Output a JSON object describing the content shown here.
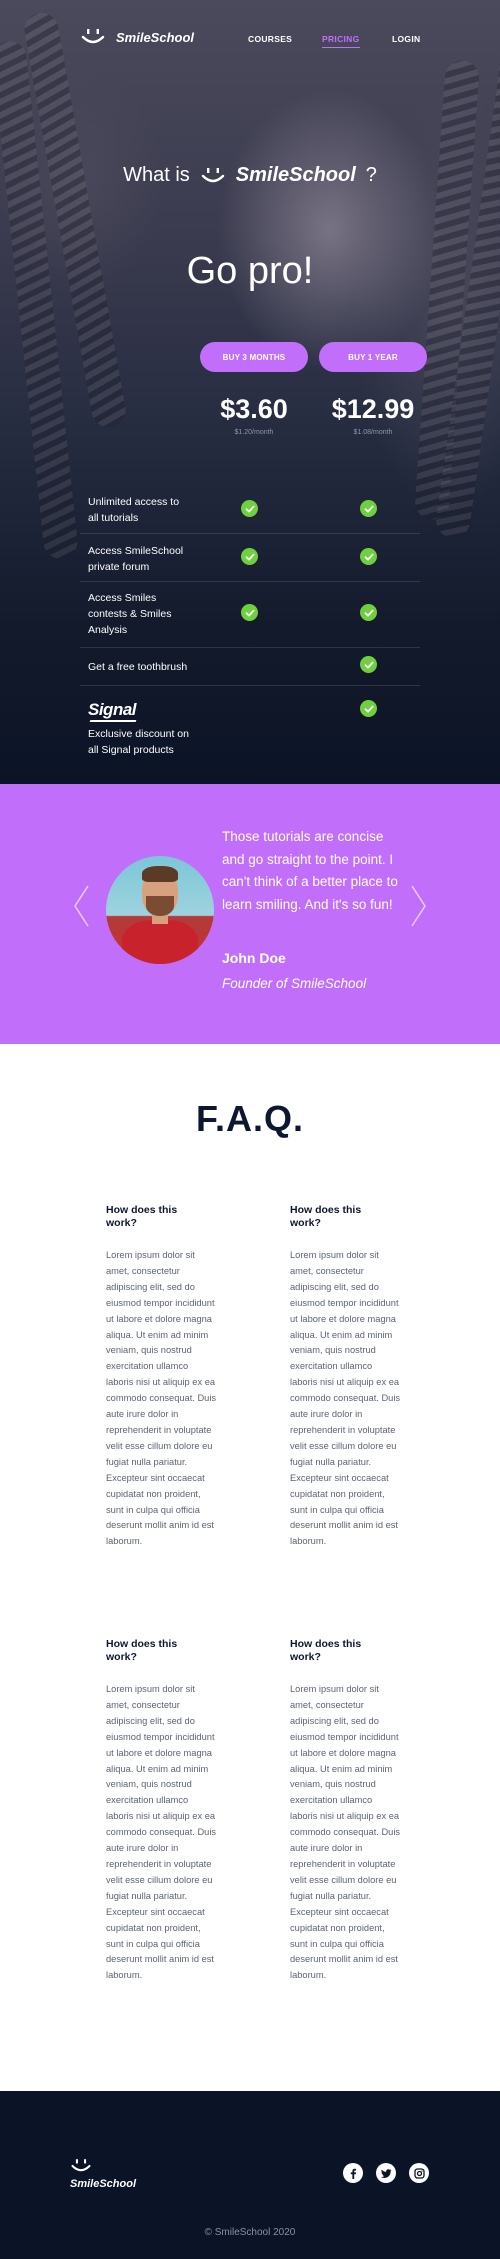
{
  "nav": {
    "brand": "SmileSchool",
    "links": [
      {
        "label": "COURSES"
      },
      {
        "label": "PRICING"
      },
      {
        "label": "LOGIN"
      }
    ]
  },
  "hero": {
    "what_is_prefix": "What is",
    "what_is_brand": "SmileSchool",
    "what_is_suffix": "?",
    "title": "Go pro!"
  },
  "pricing": {
    "plans": [
      {
        "button": "BUY 3 MONTHS",
        "price": "$3.60",
        "sub": "$1.20/month"
      },
      {
        "button": "BUY 1 YEAR",
        "price": "$12.99",
        "sub": "$1.08/month"
      }
    ],
    "features": [
      {
        "label": "Unlimited access to all tutorials",
        "plan1": true,
        "plan2": true
      },
      {
        "label": "Access SmileSchool private forum",
        "plan1": true,
        "plan2": true
      },
      {
        "label": "Access Smiles contests & Smiles Analysis",
        "plan1": true,
        "plan2": true
      },
      {
        "label": "Get a free toothbrush",
        "plan1": false,
        "plan2": true
      },
      {
        "label": "Exclusive discount on all Signal products",
        "plan1": false,
        "plan2": true,
        "logo": "Signal"
      }
    ],
    "check_color": "#6fcf3e"
  },
  "testimonial": {
    "quote": "Those tutorials are concise and go straight to the point. I can't think of a better place to learn smiling. And it's so fun!",
    "name": "John Doe",
    "role": "Founder of SmileSchool",
    "background": "#c16efb"
  },
  "faq": {
    "title": "F.A.Q.",
    "items": [
      {
        "question": "How does this work?",
        "answer": "Lorem ipsum dolor sit amet, consectetur adipiscing elit, sed do eiusmod tempor incididunt ut labore et dolore magna aliqua. Ut enim ad minim veniam, quis nostrud exercitation ullamco laboris nisi ut aliquip ex ea commodo consequat. Duis aute irure dolor in reprehenderit in voluptate velit esse cillum dolore eu fugiat nulla pariatur. Excepteur sint occaecat cupidatat non proident, sunt in culpa qui officia deserunt mollit anim id est laborum."
      },
      {
        "question": "How does this work?",
        "answer": "Lorem ipsum dolor sit amet, consectetur adipiscing elit, sed do eiusmod tempor incididunt ut labore et dolore magna aliqua. Ut enim ad minim veniam, quis nostrud exercitation ullamco laboris nisi ut aliquip ex ea commodo consequat. Duis aute irure dolor in reprehenderit in voluptate velit esse cillum dolore eu fugiat nulla pariatur. Excepteur sint occaecat cupidatat non proident, sunt in culpa qui officia deserunt mollit anim id est laborum."
      },
      {
        "question": "How does this work?",
        "answer": "Lorem ipsum dolor sit amet, consectetur adipiscing elit, sed do eiusmod tempor incididunt ut labore et dolore magna aliqua. Ut enim ad minim veniam, quis nostrud exercitation ullamco laboris nisi ut aliquip ex ea commodo consequat. Duis aute irure dolor in reprehenderit in voluptate velit esse cillum dolore eu fugiat nulla pariatur. Excepteur sint occaecat cupidatat non proident, sunt in culpa qui officia deserunt mollit anim id est laborum."
      },
      {
        "question": "How does this work?",
        "answer": "Lorem ipsum dolor sit amet, consectetur adipiscing elit, sed do eiusmod tempor incididunt ut labore et dolore magna aliqua. Ut enim ad minim veniam, quis nostrud exercitation ullamco laboris nisi ut aliquip ex ea commodo consequat. Duis aute irure dolor in reprehenderit in voluptate velit esse cillum dolore eu fugiat nulla pariatur. Excepteur sint occaecat cupidatat non proident, sunt in culpa qui officia deserunt mollit anim id est laborum."
      }
    ]
  },
  "footer": {
    "brand": "SmileSchool",
    "social": [
      "facebook-icon",
      "twitter-icon",
      "instagram-icon"
    ],
    "copyright": "© SmileSchool 2020"
  },
  "colors": {
    "accent": "#c16efb",
    "dark": "#0b1426",
    "heading": "#0d1730"
  }
}
